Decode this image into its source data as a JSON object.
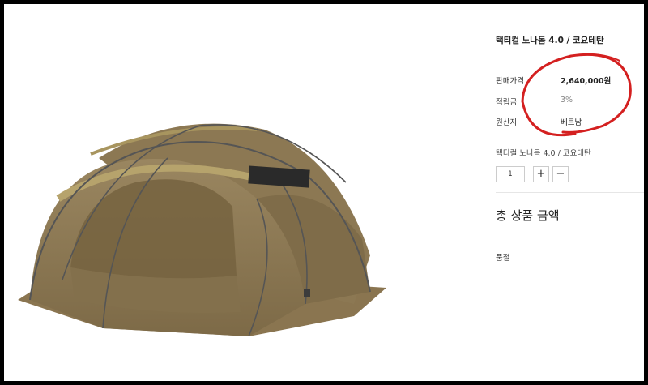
{
  "product": {
    "title": "택티컬 노나돔 4.0 / 코요테탄",
    "image_alt": "tent-image"
  },
  "info": {
    "price_label": "판매가격",
    "price_value": "2,640,000원",
    "points_label": "적립금",
    "points_value": "3%",
    "origin_label": "원산지",
    "origin_value": "베트남"
  },
  "option": {
    "name": "택티컬 노나돔 4.0 / 코요테탄",
    "quantity": "1",
    "plus": "+",
    "minus": "−"
  },
  "summary": {
    "total_label": "총 상품 금액",
    "status": "품절"
  },
  "colors": {
    "annotation": "#d42020",
    "tent_body": "#8f7a55",
    "tent_trim": "#a9975f"
  }
}
